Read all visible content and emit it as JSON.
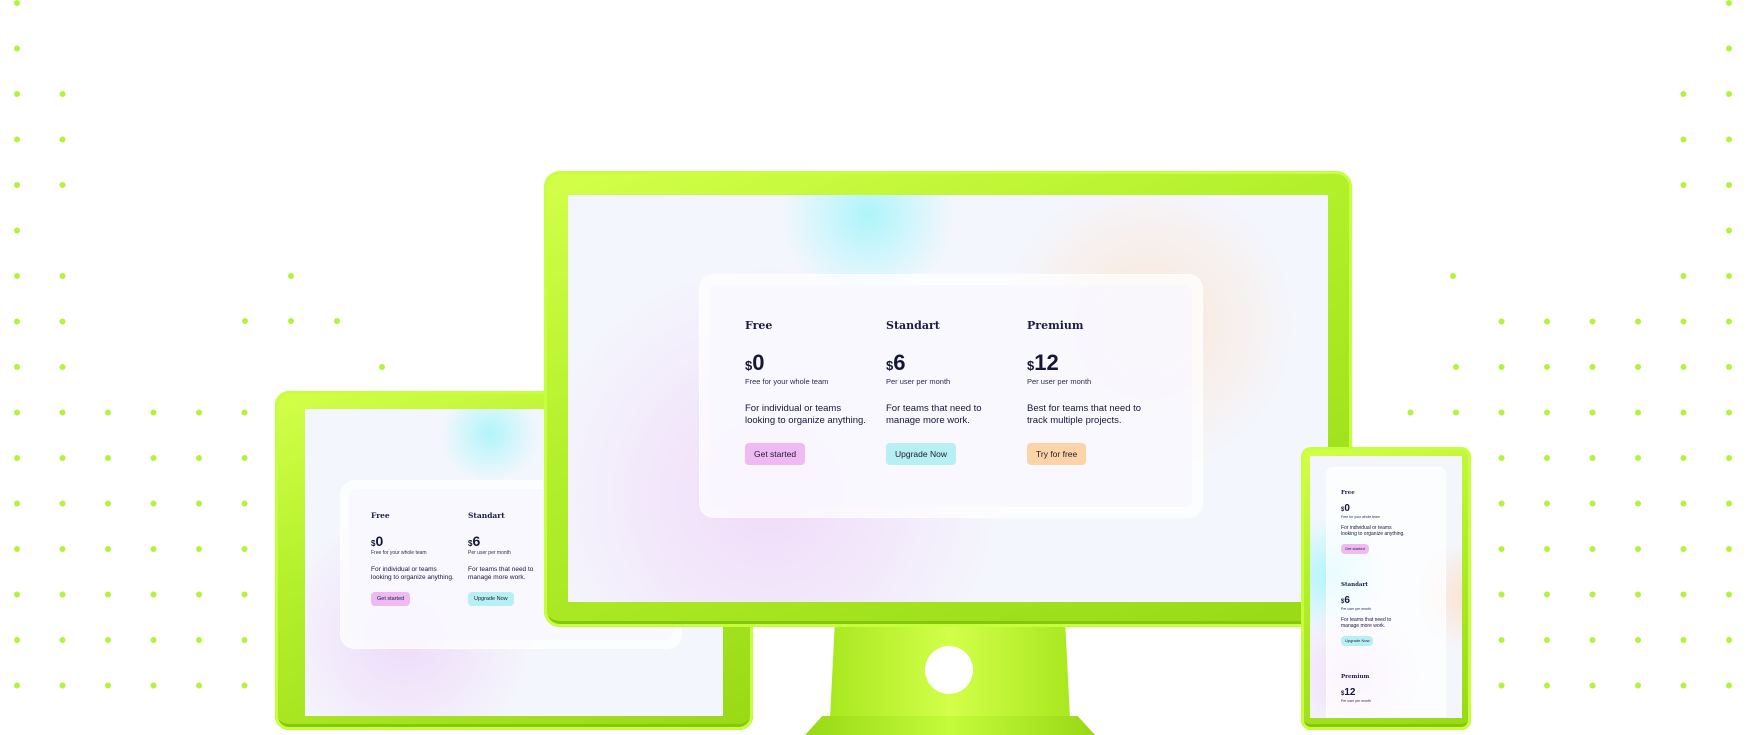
{
  "colors": {
    "accent_green": "#b8f22c",
    "dot_green": "#b5f23a",
    "button_free": "#efb9f4",
    "button_standart": "#b6eff4",
    "button_premium": "#fdd3a8",
    "text_dark": "#14163a"
  },
  "plans": [
    {
      "name": "Free",
      "currency": "$",
      "price": "0",
      "price_note": "Free for your whole team",
      "description_line1": "For individual or teams",
      "description_line2": "looking to organize anything.",
      "button_label": "Get started"
    },
    {
      "name": "Standart",
      "currency": "$",
      "price": "6",
      "price_note": "Per user per month",
      "description_line1": "For teams that need to",
      "description_line2": "manage more work.",
      "button_label": "Upgrade Now"
    },
    {
      "name": "Premium",
      "currency": "$",
      "price": "12",
      "price_note": "Per user per month",
      "description_line1": "Best for teams that need to",
      "description_line2": "track multiple projects.",
      "button_label": "Try for free"
    }
  ],
  "icons": {
    "monitor_logo": "circle-logo-icon"
  }
}
